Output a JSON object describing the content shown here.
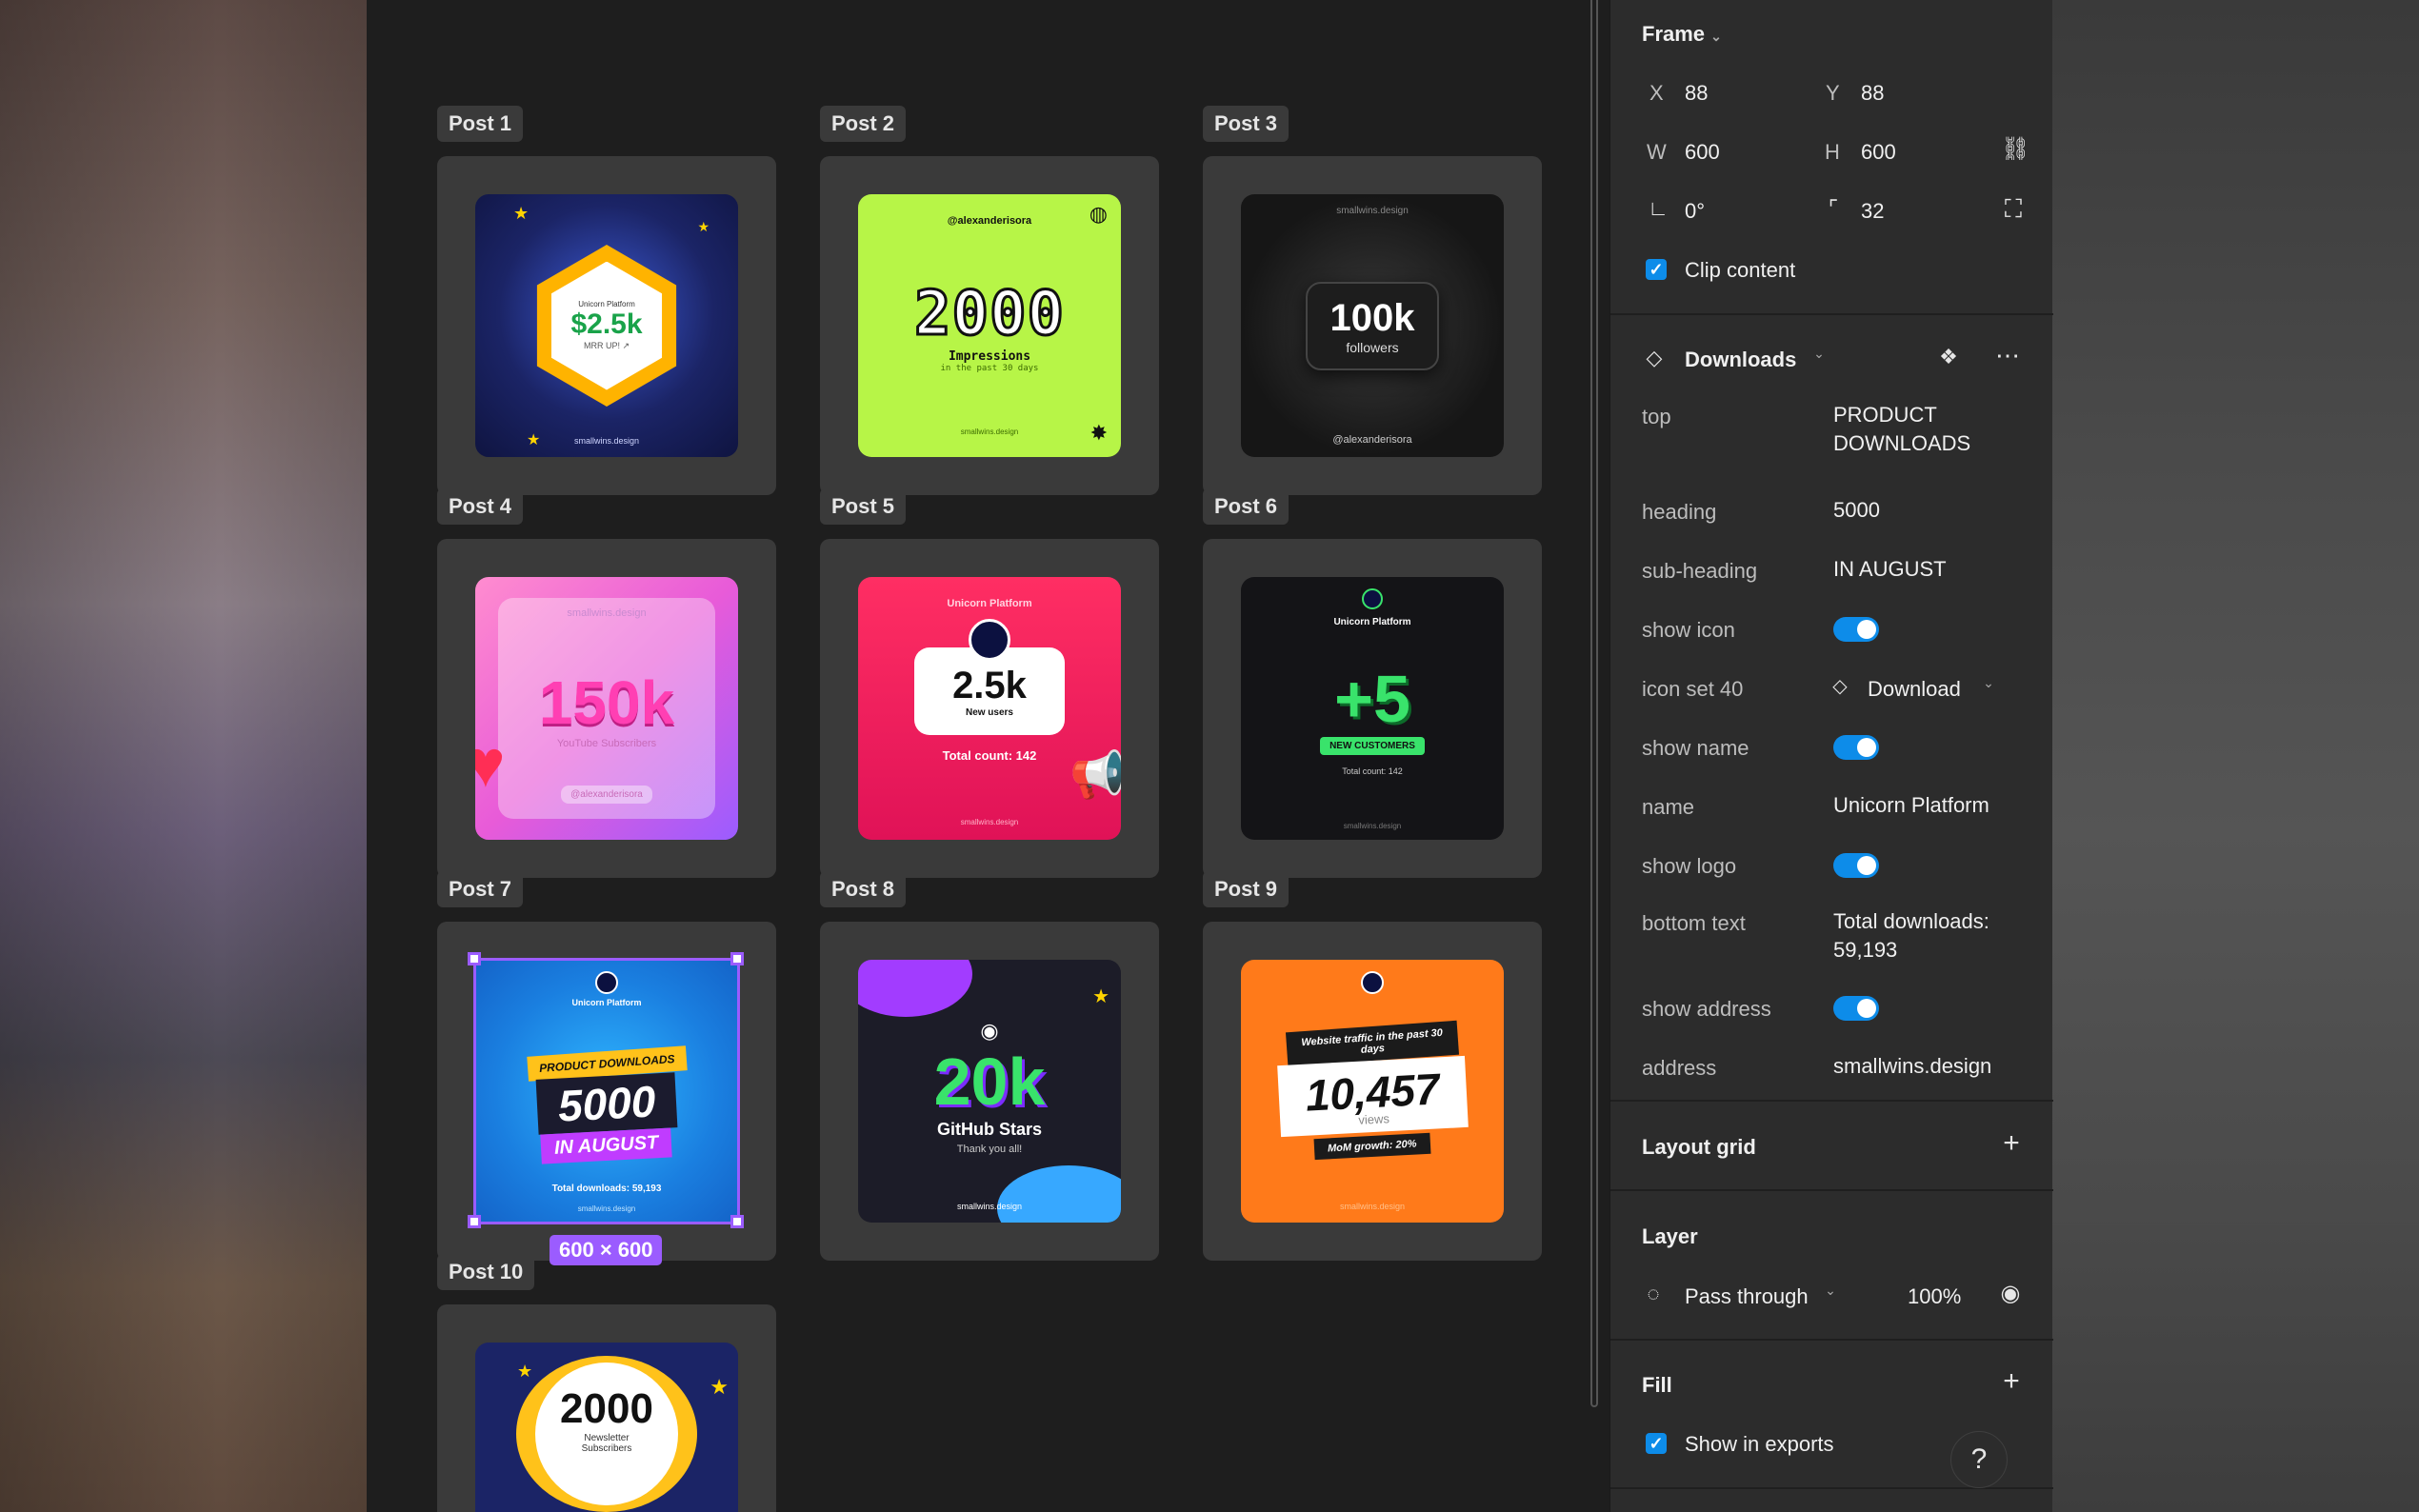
{
  "posts": [
    {
      "label": "Post 1",
      "lines": [
        "Unicorn Platform",
        "$2.5k",
        "MRR UP! ↗",
        "smallwins.design"
      ]
    },
    {
      "label": "Post 2",
      "lines": [
        "@alexanderisora",
        "2000",
        "Impressions",
        "in the past 30 days",
        "smallwins.design"
      ]
    },
    {
      "label": "Post 3",
      "lines": [
        "smallwins.design",
        "100k",
        "followers",
        "@alexanderisora"
      ]
    },
    {
      "label": "Post 4",
      "lines": [
        "smallwins.design",
        "150k",
        "YouTube Subscribers",
        "@alexanderisora"
      ]
    },
    {
      "label": "Post 5",
      "lines": [
        "Unicorn Platform",
        "2.5k",
        "New users",
        "Total count: 142",
        "smallwins.design"
      ]
    },
    {
      "label": "Post 6",
      "lines": [
        "Unicorn Platform",
        "+5",
        "NEW CUSTOMERS",
        "Total count: 142",
        "smallwins.design"
      ]
    },
    {
      "label": "Post 7",
      "lines": [
        "Unicorn Platform",
        "PRODUCT DOWNLOADS",
        "5000",
        "IN AUGUST",
        "Total downloads: 59,193",
        "smallwins.design"
      ]
    },
    {
      "label": "Post 8",
      "lines": [
        "20k",
        "GitHub Stars",
        "Thank you all!",
        "smallwins.design"
      ]
    },
    {
      "label": "Post 9",
      "lines": [
        "Website traffic in the past 30 days",
        "10,457",
        "views",
        "MoM growth: 20%",
        "smallwins.design"
      ]
    },
    {
      "label": "Post 10",
      "lines": [
        "2000",
        "Newsletter",
        "Subscribers"
      ]
    }
  ],
  "selection": {
    "size_label": "600 × 600"
  },
  "frame": {
    "title": "Frame",
    "x_label": "X",
    "x": "88",
    "y_label": "Y",
    "y": "88",
    "w_label": "W",
    "w": "600",
    "h_label": "H",
    "h": "600",
    "rotation": "0°",
    "radius": "32",
    "clip_content": "Clip content"
  },
  "component": {
    "title": "Downloads",
    "props": [
      {
        "key": "top",
        "value": "PRODUCT\nDOWNLOADS",
        "type": "text"
      },
      {
        "key": "heading",
        "value": "5000",
        "type": "text"
      },
      {
        "key": "sub-heading",
        "value": "IN AUGUST",
        "type": "text"
      },
      {
        "key": "show icon",
        "value": "",
        "type": "toggle"
      },
      {
        "key": "icon set 40",
        "value": "Download",
        "type": "instance"
      },
      {
        "key": "show name",
        "value": "",
        "type": "toggle"
      },
      {
        "key": "name",
        "value": "Unicorn Platform",
        "type": "text"
      },
      {
        "key": "show logo",
        "value": "",
        "type": "toggle"
      },
      {
        "key": "bottom text",
        "value": "Total downloads:\n59,193",
        "type": "text"
      },
      {
        "key": "show address",
        "value": "",
        "type": "toggle"
      },
      {
        "key": "address",
        "value": "smallwins.design",
        "type": "text"
      }
    ]
  },
  "layout_grid": {
    "title": "Layout grid"
  },
  "layer": {
    "title": "Layer",
    "blend": "Pass through",
    "opacity": "100%"
  },
  "fill": {
    "title": "Fill",
    "show_in_exports": "Show in exports"
  },
  "help": {
    "label": "?"
  },
  "colors": {
    "accent": "#0d8ce9",
    "selection": "#9b5cff",
    "panel": "#2c2c2c",
    "canvas": "#1e1e1e"
  }
}
